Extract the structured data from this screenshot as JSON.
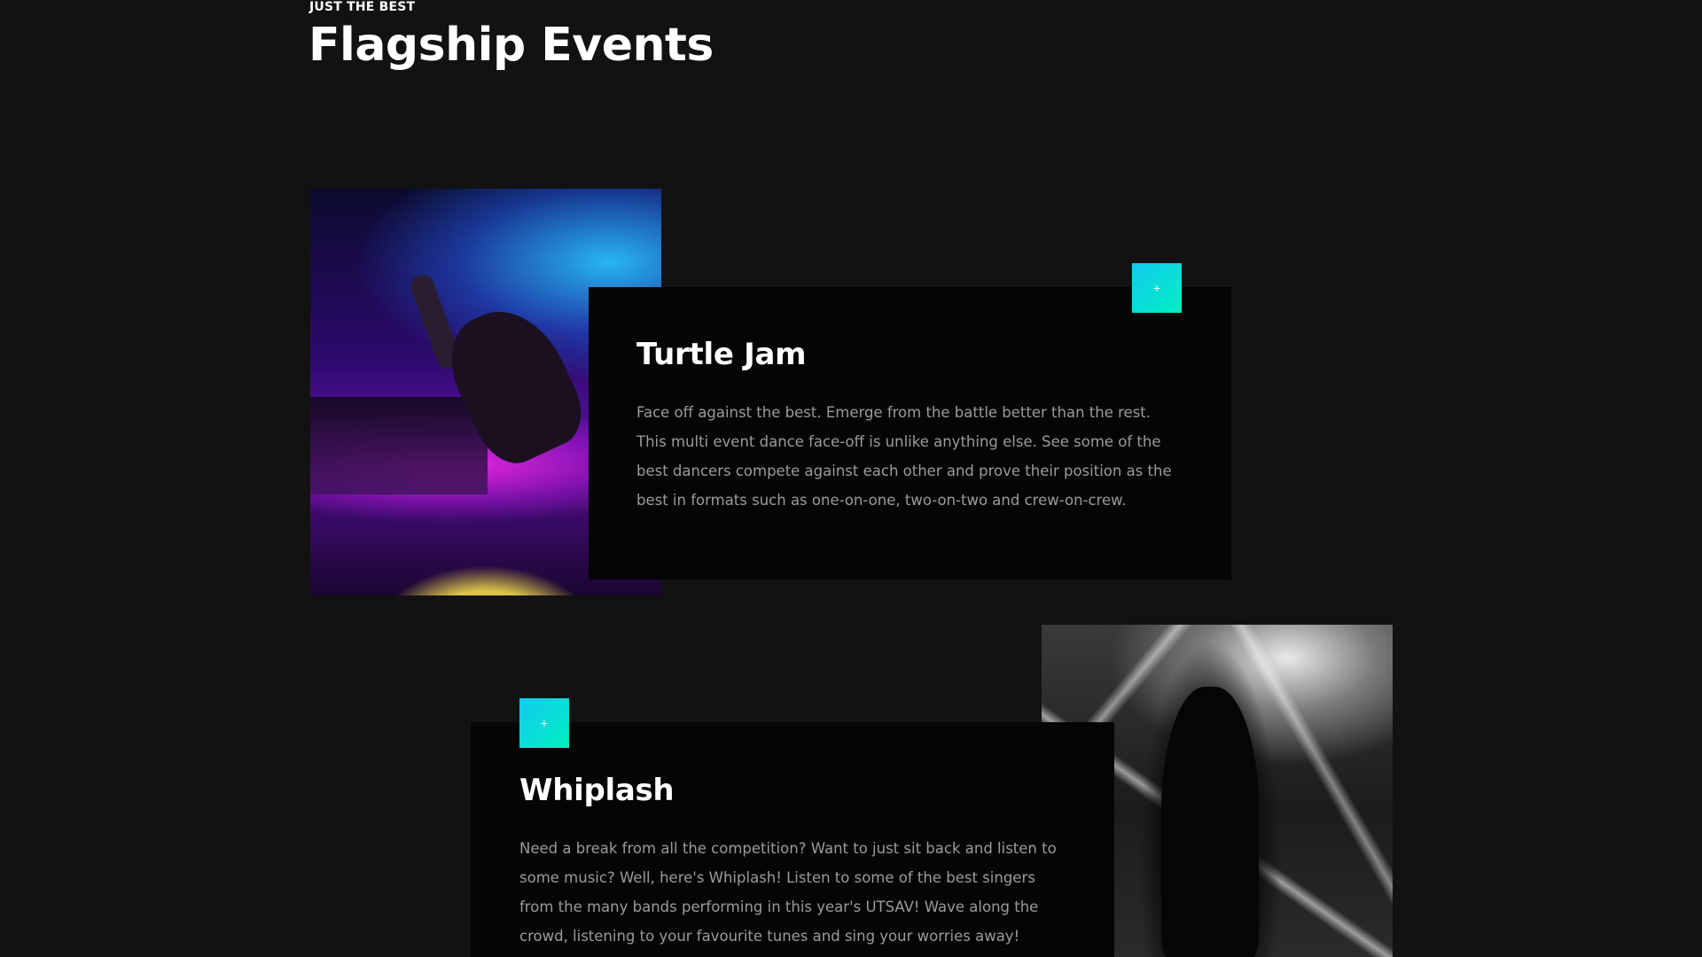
{
  "section": {
    "eyebrow": "JUST THE BEST",
    "title": "Flagship Events"
  },
  "events": [
    {
      "title": "Turtle Jam",
      "description": "Face off against the best. Emerge from the battle better than the rest. This multi event dance face-off is unlike anything else. See some of the best dancers compete against each other and prove their position as the best in formats such as one-on-one, two-on-two and crew-on-crew.",
      "expand_icon": "plus-icon",
      "expand_label": "+",
      "image_subject": "breakdancer-on-stage"
    },
    {
      "title": "Whiplash",
      "description": "Need a break from all the competition? Want to just sit back and listen to some music? Well, here's Whiplash! Listen to some of the best singers from the many bands performing in this year's UTSAV! Wave along the crowd, listening to your favourite tunes and sing your worries away!",
      "expand_icon": "plus-icon",
      "expand_label": "+",
      "image_subject": "guitarist-on-stage"
    }
  ],
  "colors": {
    "background": "#121212",
    "card": "#050505",
    "accent_start": "#14c9f0",
    "accent_end": "#00f0c0",
    "text_primary": "#ffffff",
    "text_secondary": "#9b9b9b"
  }
}
